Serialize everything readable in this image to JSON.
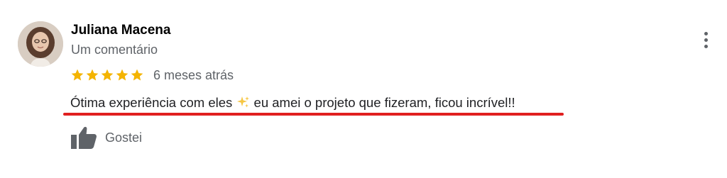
{
  "review": {
    "author_name": "Juliana Macena",
    "review_count": "Um comentário",
    "rating": 5,
    "rating_max": 5,
    "date": "6 meses atrás",
    "text_before_emoji": "Ótima experiência com eles ",
    "emoji": "sparkles-emoji",
    "text_after_emoji": " eu amei o projeto que fizeram, ficou incrível!!",
    "like_label": "Gostei"
  },
  "icons": {
    "more": "more-vert-icon",
    "star": "star-icon",
    "like": "thumbs-up-icon"
  },
  "colors": {
    "star": "#f4b400",
    "secondary_text": "#5f6368",
    "underline_annotation": "#e02020"
  }
}
